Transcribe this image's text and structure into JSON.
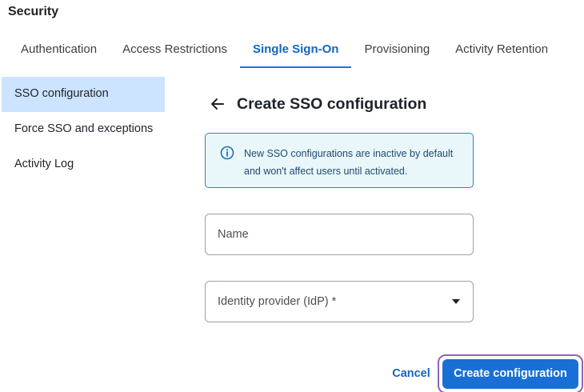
{
  "page": {
    "title": "Security"
  },
  "tabs": [
    {
      "label": "Authentication",
      "active": false
    },
    {
      "label": "Access Restrictions",
      "active": false
    },
    {
      "label": "Single Sign-On",
      "active": true
    },
    {
      "label": "Provisioning",
      "active": false
    },
    {
      "label": "Activity Retention",
      "active": false
    }
  ],
  "sidebar": {
    "items": [
      {
        "label": "SSO configuration",
        "active": true
      },
      {
        "label": "Force SSO and exceptions",
        "active": false
      },
      {
        "label": "Activity Log",
        "active": false
      }
    ]
  },
  "form": {
    "back_icon": "arrow-left-icon",
    "title": "Create SSO configuration",
    "info": {
      "icon": "info-circle-icon",
      "text": "New SSO configurations are inactive by default and won't affect users until activated."
    },
    "name_field": {
      "placeholder": "Name",
      "value": ""
    },
    "idp_field": {
      "placeholder": "Identity provider (IdP) *",
      "value": "",
      "icon": "caret-down-icon"
    }
  },
  "actions": {
    "cancel_label": "Cancel",
    "create_label": "Create configuration"
  },
  "colors": {
    "accent": "#1a6fd6",
    "active_sidebar_bg": "#cce4ff",
    "info_bg": "#e9f7fa",
    "info_border": "#1f8fb0",
    "focus_ring": "#8e63b8"
  }
}
